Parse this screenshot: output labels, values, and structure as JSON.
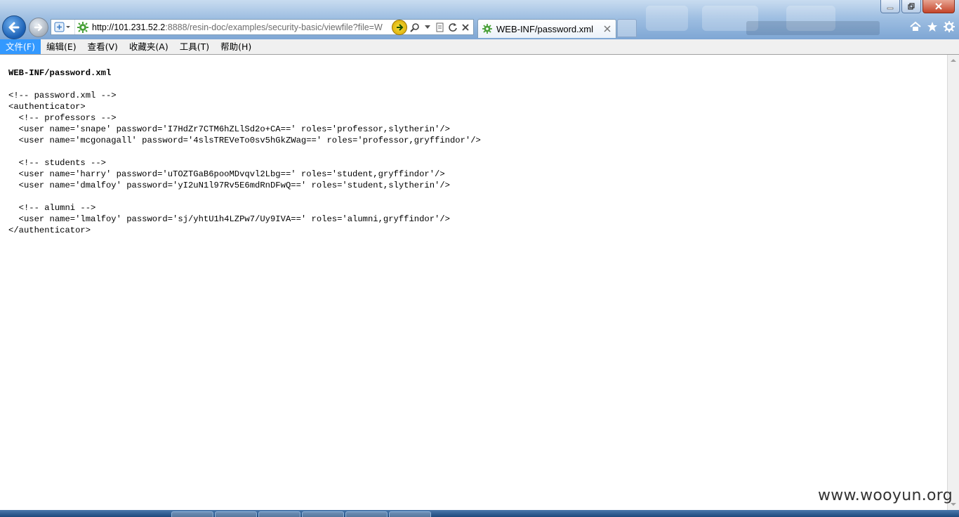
{
  "window": {
    "minimize_icon": "minimize-icon",
    "restore_icon": "restore-icon",
    "close_icon": "close-icon"
  },
  "nav": {
    "back_icon": "arrow-left-icon",
    "forward_icon": "arrow-right-icon"
  },
  "address": {
    "url_host": "http://101.231.52.2",
    "url_rest": ":8888/resin-doc/examples/security-basic/viewfile?file=W"
  },
  "tab": {
    "title": "WEB-INF/password.xml"
  },
  "menu": [
    {
      "label": "文件(F)",
      "active": true
    },
    {
      "label": "编辑(E)"
    },
    {
      "label": "查看(V)"
    },
    {
      "label": "收藏夹(A)"
    },
    {
      "label": "工具(T)"
    },
    {
      "label": "帮助(H)"
    }
  ],
  "document": {
    "title": "WEB-INF/password.xml",
    "lines": [
      "<!-- password.xml -->",
      "<authenticator>",
      "  <!-- professors -->",
      "  <user name='snape' password='I7HdZr7CTM6hZLlSd2o+CA==' roles='professor,slytherin'/>",
      "  <user name='mcgonagall' password='4slsTREVeTo0sv5hGkZWag==' roles='professor,gryffindor'/>",
      "",
      "  <!-- students -->",
      "  <user name='harry' password='uTOZTGaB6pooMDvqvl2Lbg==' roles='student,gryffindor'/>",
      "  <user name='dmalfoy' password='yI2uN1l97Rv5E6mdRnDFwQ==' roles='student,slytherin'/>",
      "",
      "  <!-- alumni -->",
      "  <user name='lmalfoy' password='sj/yhtU1h4LZPw7/Uy9IVA==' roles='alumni,gryffindor'/>",
      "</authenticator>"
    ]
  },
  "watermark": "www.wooyun.org"
}
